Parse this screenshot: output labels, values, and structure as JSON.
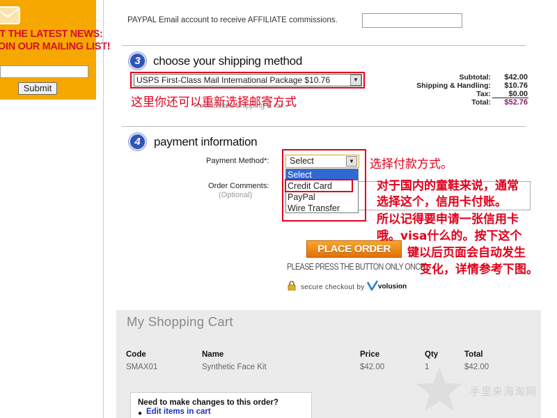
{
  "newsletter": {
    "line1": "ET THE LATEST NEWS:",
    "line2": "OIN OUR MAILING LIST!",
    "input_value": "",
    "submit_label": "Submit"
  },
  "affiliate": {
    "label": "PAYPAL Email account to receive AFFILIATE commissions.",
    "input_value": ""
  },
  "shipping": {
    "step": "3",
    "title": "choose your shipping method",
    "selected": "USPS First-Class Mail International Package $10.76",
    "recalc_link": "recalculate shipping & tax",
    "annotation": "这里你还可以重新选择邮寄方式"
  },
  "totals": {
    "subtotal_label": "Subtotal:",
    "subtotal_value": "$42.00",
    "shipping_label": "Shipping & Handling:",
    "shipping_value": "$10.76",
    "tax_label": "Tax:",
    "tax_value": "$0.00",
    "total_label": "Total:",
    "total_value": "$52.76"
  },
  "payment": {
    "step": "4",
    "title": "payment information",
    "method_label": "Payment Method*:",
    "selected": "Select",
    "options": [
      "Select",
      "Credit Card",
      "PayPal",
      "Wire Transfer"
    ],
    "comments_label": "Order Comments:",
    "comments_optional": "(Optional)",
    "comments_value": "",
    "annotation_title": "选择付款方式。",
    "annotation_lines": [
      "对于国内的童鞋来说，通常",
      "选择这个，信用卡付账。",
      "所以记得要申请一张信用卡",
      "哦。visa什么的。按下这个",
      "键以后页面会自动发生",
      "变化，详情参考下图。"
    ]
  },
  "place_order": {
    "button_label": "PLACE ORDER",
    "press_once": "PLEASE PRESS THE BUTTON ONLY ONCE.",
    "secure_text": "secure checkout by",
    "brand": "volusion"
  },
  "cart": {
    "title": "My Shopping Cart",
    "columns": [
      "Code",
      "Name",
      "Price",
      "Qty",
      "Total"
    ],
    "rows": [
      {
        "code": "SMAX01",
        "name": "Synthetic Face Kit",
        "price": "$42.00",
        "qty": "1",
        "total": "$42.00"
      }
    ],
    "changes_question": "Need to make changes to this order?",
    "edit_link": "Edit items in cart"
  },
  "watermark": {
    "text": "手里来海淘网"
  },
  "colors": {
    "newsletter_bg": "#f6a800",
    "annotation_red": "#e0001b",
    "step_blue": "#2f55b6",
    "total_purple": "#8b1a6b",
    "link_blue": "#1b2fbf",
    "place_order_orange": "#e37000"
  }
}
